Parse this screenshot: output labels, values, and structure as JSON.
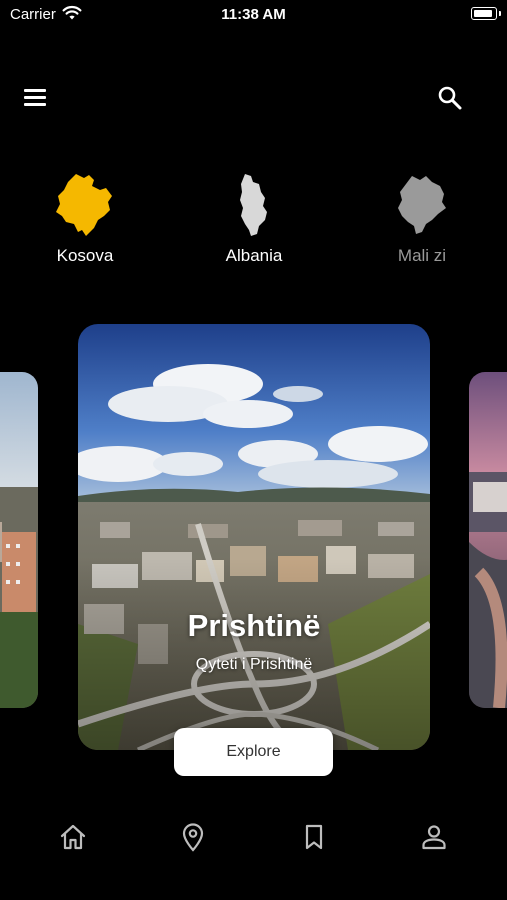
{
  "status_bar": {
    "carrier": "Carrier",
    "time": "11:38 AM"
  },
  "header": {
    "menu_icon": "hamburger-menu-icon",
    "search_icon": "search-icon"
  },
  "countries": [
    {
      "label": "Kosova",
      "color": "#F5B800",
      "selected": true
    },
    {
      "label": "Albania",
      "color": "#D8D8D8",
      "selected": false
    },
    {
      "label": "Mali zi",
      "color": "#9A9A9A",
      "selected": false
    }
  ],
  "carousel": {
    "current": {
      "title": "Prishtinë",
      "subtitle": "Qyteti i Prishtinë"
    },
    "explore_label": "Explore"
  },
  "bottom_nav": [
    {
      "name": "home",
      "icon": "home-icon"
    },
    {
      "name": "location",
      "icon": "location-pin-icon"
    },
    {
      "name": "bookmarks",
      "icon": "bookmark-icon"
    },
    {
      "name": "profile",
      "icon": "person-icon"
    }
  ],
  "colors": {
    "background": "#000000",
    "accent": "#F5B800",
    "nav_icon": "#BDBDBD"
  }
}
